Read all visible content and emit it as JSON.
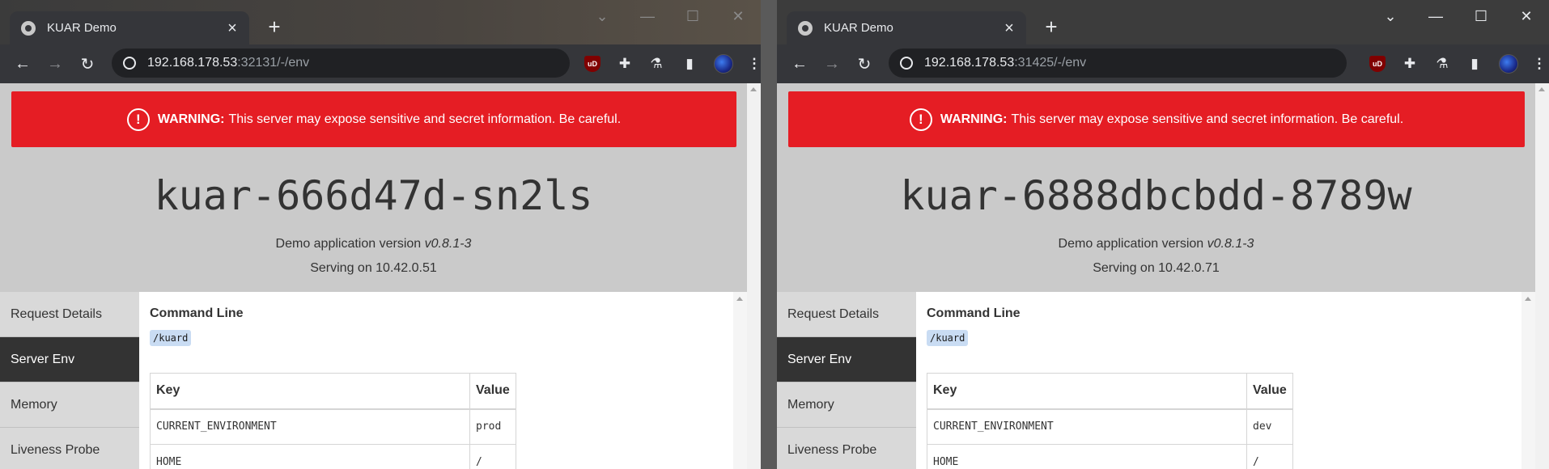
{
  "windows": [
    {
      "tab_title": "KUAR Demo",
      "url_host": "192.168.178.53",
      "url_rest": ":32131/-/env",
      "warning_label": "WARNING:",
      "warning_text": "This server may expose sensitive and secret information. Be careful.",
      "hostname": "kuar-666d47d-sn2ls",
      "version_prefix": "Demo application version",
      "version": "v0.8.1-3",
      "serving": "Serving on 10.42.0.51",
      "sidebar": [
        "Request Details",
        "Server Env",
        "Memory",
        "Liveness Probe"
      ],
      "active_sidebar": "Server Env",
      "command_line_title": "Command Line",
      "command_line": "/kuard",
      "table_headers": [
        "Key",
        "Value"
      ],
      "rows": [
        [
          "CURRENT_ENVIRONMENT",
          "prod"
        ],
        [
          "HOME",
          "/"
        ]
      ]
    },
    {
      "tab_title": "KUAR Demo",
      "url_host": "192.168.178.53",
      "url_rest": ":31425/-/env",
      "warning_label": "WARNING:",
      "warning_text": "This server may expose sensitive and secret information. Be careful.",
      "hostname": "kuar-6888dbcbdd-8789w",
      "version_prefix": "Demo application version",
      "version": "v0.8.1-3",
      "serving": "Serving on 10.42.0.71",
      "sidebar": [
        "Request Details",
        "Server Env",
        "Memory",
        "Liveness Probe"
      ],
      "active_sidebar": "Server Env",
      "command_line_title": "Command Line",
      "command_line": "/kuard",
      "table_headers": [
        "Key",
        "Value"
      ],
      "rows": [
        [
          "CURRENT_ENVIRONMENT",
          "dev"
        ],
        [
          "HOME",
          "/"
        ]
      ]
    }
  ],
  "icons": {
    "tab_close": "×",
    "new_tab": "+",
    "back": "←",
    "forward": "→",
    "reload": "↻",
    "extensions": "puzzle-icon",
    "labs": "flask-icon",
    "side_panel": "side-panel-icon",
    "menu": "⋮"
  },
  "colors": {
    "warning_bg": "#e51d24",
    "active_sidebar_bg": "#333333",
    "page_bg": "#cacaca",
    "code_bg": "#c9dcf3"
  }
}
